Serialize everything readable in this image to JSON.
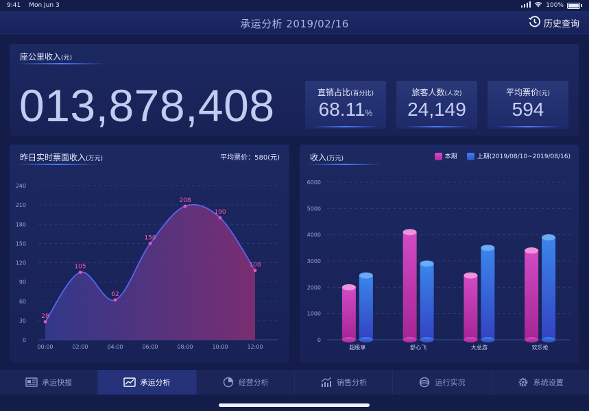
{
  "status_bar": {
    "time": "9:41",
    "date": "Mon Jun 3",
    "battery": "100%"
  },
  "header": {
    "title": "承运分析 2019/02/16",
    "history_label": "历史查询"
  },
  "top_panel": {
    "title": "座公里收入",
    "title_unit": "(元)",
    "big_value": "013,878,408",
    "stats": [
      {
        "label": "直销占比",
        "unit_note": "(百分比)",
        "value": "68.11",
        "suffix": "%"
      },
      {
        "label": "旅客人数",
        "unit_note": "(人次)",
        "value": "24,149",
        "suffix": ""
      },
      {
        "label": "平均票价",
        "unit_note": "(元)",
        "value": "594",
        "suffix": ""
      }
    ]
  },
  "line_panel": {
    "title": "昨日实时票面收入",
    "title_unit": "(万元)",
    "avg_price_label": "平均票价：580(元)"
  },
  "bar_panel": {
    "title": "收入",
    "title_unit": "(万元)",
    "legend_current": "本期",
    "legend_previous": "上期(2019/08/10~2019/08/16)"
  },
  "chart_data": [
    {
      "type": "area",
      "x": [
        "00:00",
        "02:00",
        "04:00",
        "06:00",
        "08:00",
        "10:00",
        "12:00"
      ],
      "y": [
        28,
        105,
        62,
        150,
        208,
        190,
        108
      ],
      "yticks": [
        0,
        30,
        60,
        90,
        120,
        150,
        180,
        210,
        240
      ],
      "ylim": [
        0,
        240
      ]
    },
    {
      "type": "bar",
      "categories": [
        "超级享",
        "舒心飞",
        "大总游",
        "欢乐抢"
      ],
      "series": [
        {
          "name": "本期",
          "values": [
            2000,
            4100,
            2450,
            3400
          ]
        },
        {
          "name": "上期(2019/08/10~2019/08/16)",
          "values": [
            2450,
            2900,
            3500,
            3900
          ]
        }
      ],
      "yticks": [
        0,
        1000,
        2000,
        3000,
        4000,
        5000,
        6000
      ],
      "ylim": [
        0,
        6000
      ]
    }
  ],
  "tabs": [
    {
      "label": "承运快报",
      "icon": "report-icon",
      "active": false
    },
    {
      "label": "承运分析",
      "icon": "analysis-icon",
      "active": true
    },
    {
      "label": "经营分析",
      "icon": "pie-icon",
      "active": false
    },
    {
      "label": "销售分析",
      "icon": "trend-icon",
      "active": false
    },
    {
      "label": "运行实况",
      "icon": "globe-icon",
      "active": false
    },
    {
      "label": "系统设置",
      "icon": "gear-icon",
      "active": false
    }
  ],
  "colors": {
    "background": "#141d4a",
    "panel": "#1c2861",
    "accent_pink": "#d63aa8",
    "accent_blue": "#3c6fe6",
    "line": "#5b64f0"
  }
}
